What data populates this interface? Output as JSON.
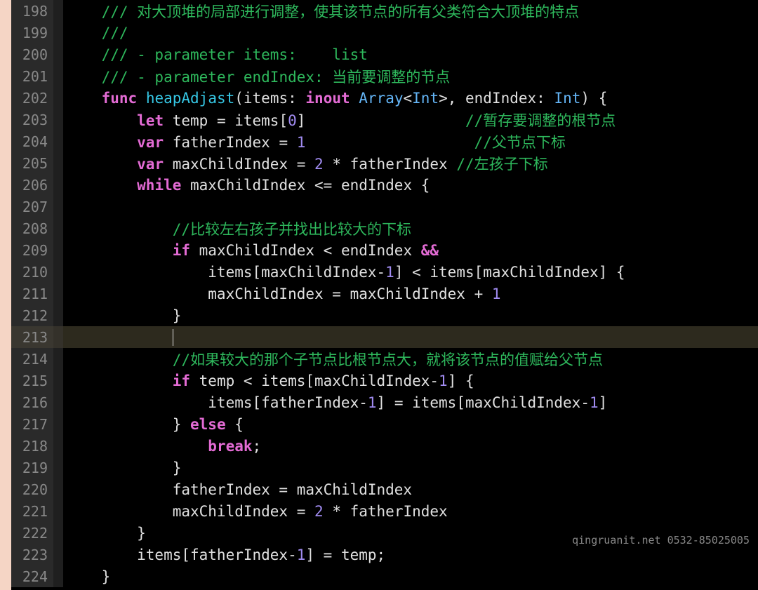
{
  "watermark": "qingruanit.net 0532-85025005",
  "lines": [
    {
      "num": "198",
      "content": [
        {
          "t": "    ",
          "c": ""
        },
        {
          "t": "/// 对大顶堆的局部进行调整，使其该节点的所有父类符合大顶堆的特点",
          "c": "c-comment"
        }
      ]
    },
    {
      "num": "199",
      "content": [
        {
          "t": "    ",
          "c": ""
        },
        {
          "t": "///",
          "c": "c-comment"
        }
      ]
    },
    {
      "num": "200",
      "content": [
        {
          "t": "    ",
          "c": ""
        },
        {
          "t": "/// - parameter items:    list",
          "c": "c-comment"
        }
      ]
    },
    {
      "num": "201",
      "content": [
        {
          "t": "    ",
          "c": ""
        },
        {
          "t": "/// - parameter endIndex: 当前要调整的节点",
          "c": "c-comment"
        }
      ]
    },
    {
      "num": "202",
      "content": [
        {
          "t": "    ",
          "c": ""
        },
        {
          "t": "func",
          "c": "c-keyword"
        },
        {
          "t": " ",
          "c": ""
        },
        {
          "t": "heapAdjast",
          "c": "c-funcname"
        },
        {
          "t": "(items: ",
          "c": "c-op"
        },
        {
          "t": "inout",
          "c": "c-keyword"
        },
        {
          "t": " ",
          "c": ""
        },
        {
          "t": "Array",
          "c": "c-type"
        },
        {
          "t": "<",
          "c": "c-op"
        },
        {
          "t": "Int",
          "c": "c-type"
        },
        {
          "t": ">, endIndex: ",
          "c": "c-op"
        },
        {
          "t": "Int",
          "c": "c-type"
        },
        {
          "t": ") {",
          "c": "c-op"
        }
      ]
    },
    {
      "num": "203",
      "content": [
        {
          "t": "        ",
          "c": ""
        },
        {
          "t": "let",
          "c": "c-keyword"
        },
        {
          "t": " temp = items[",
          "c": "c-op"
        },
        {
          "t": "0",
          "c": "c-number"
        },
        {
          "t": "]                  ",
          "c": "c-op"
        },
        {
          "t": "//暂存要调整的根节点",
          "c": "c-comment"
        }
      ]
    },
    {
      "num": "204",
      "content": [
        {
          "t": "        ",
          "c": ""
        },
        {
          "t": "var",
          "c": "c-keyword"
        },
        {
          "t": " fatherIndex = ",
          "c": "c-op"
        },
        {
          "t": "1",
          "c": "c-number"
        },
        {
          "t": "                   ",
          "c": "c-op"
        },
        {
          "t": "//父节点下标",
          "c": "c-comment"
        }
      ]
    },
    {
      "num": "205",
      "content": [
        {
          "t": "        ",
          "c": ""
        },
        {
          "t": "var",
          "c": "c-keyword"
        },
        {
          "t": " maxChildIndex = ",
          "c": "c-op"
        },
        {
          "t": "2",
          "c": "c-number"
        },
        {
          "t": " * fatherIndex ",
          "c": "c-op"
        },
        {
          "t": "//左孩子下标",
          "c": "c-comment"
        }
      ]
    },
    {
      "num": "206",
      "content": [
        {
          "t": "        ",
          "c": ""
        },
        {
          "t": "while",
          "c": "c-keyword"
        },
        {
          "t": " maxChildIndex <= endIndex {",
          "c": "c-op"
        }
      ]
    },
    {
      "num": "207",
      "content": [
        {
          "t": "",
          "c": ""
        }
      ]
    },
    {
      "num": "208",
      "content": [
        {
          "t": "            ",
          "c": ""
        },
        {
          "t": "//比较左右孩子并找出比较大的下标",
          "c": "c-comment"
        }
      ]
    },
    {
      "num": "209",
      "content": [
        {
          "t": "            ",
          "c": ""
        },
        {
          "t": "if",
          "c": "c-keyword"
        },
        {
          "t": " maxChildIndex < endIndex ",
          "c": "c-op"
        },
        {
          "t": "&&",
          "c": "c-keyword"
        }
      ]
    },
    {
      "num": "210",
      "content": [
        {
          "t": "                items[maxChildIndex-",
          "c": "c-op"
        },
        {
          "t": "1",
          "c": "c-number"
        },
        {
          "t": "] < items[maxChildIndex] {",
          "c": "c-op"
        }
      ]
    },
    {
      "num": "211",
      "content": [
        {
          "t": "                maxChildIndex = maxChildIndex + ",
          "c": "c-op"
        },
        {
          "t": "1",
          "c": "c-number"
        }
      ]
    },
    {
      "num": "212",
      "content": [
        {
          "t": "            }",
          "c": "c-op"
        }
      ]
    },
    {
      "num": "213",
      "current": true,
      "content": [
        {
          "t": "            ",
          "c": ""
        },
        {
          "cursor": true
        }
      ]
    },
    {
      "num": "214",
      "content": [
        {
          "t": "            ",
          "c": ""
        },
        {
          "t": "//如果较大的那个子节点比根节点大，就将该节点的值赋给父节点",
          "c": "c-comment"
        }
      ]
    },
    {
      "num": "215",
      "content": [
        {
          "t": "            ",
          "c": ""
        },
        {
          "t": "if",
          "c": "c-keyword"
        },
        {
          "t": " temp < items[maxChildIndex-",
          "c": "c-op"
        },
        {
          "t": "1",
          "c": "c-number"
        },
        {
          "t": "] {",
          "c": "c-op"
        }
      ]
    },
    {
      "num": "216",
      "content": [
        {
          "t": "                items[fatherIndex-",
          "c": "c-op"
        },
        {
          "t": "1",
          "c": "c-number"
        },
        {
          "t": "] = items[maxChildIndex-",
          "c": "c-op"
        },
        {
          "t": "1",
          "c": "c-number"
        },
        {
          "t": "]",
          "c": "c-op"
        }
      ]
    },
    {
      "num": "217",
      "content": [
        {
          "t": "            } ",
          "c": "c-op"
        },
        {
          "t": "else",
          "c": "c-keyword"
        },
        {
          "t": " {",
          "c": "c-op"
        }
      ]
    },
    {
      "num": "218",
      "content": [
        {
          "t": "                ",
          "c": ""
        },
        {
          "t": "break",
          "c": "c-break"
        },
        {
          "t": ";",
          "c": "c-op"
        }
      ]
    },
    {
      "num": "219",
      "content": [
        {
          "t": "            }",
          "c": "c-op"
        }
      ]
    },
    {
      "num": "220",
      "content": [
        {
          "t": "            fatherIndex = maxChildIndex",
          "c": "c-op"
        }
      ]
    },
    {
      "num": "221",
      "content": [
        {
          "t": "            maxChildIndex = ",
          "c": "c-op"
        },
        {
          "t": "2",
          "c": "c-number"
        },
        {
          "t": " * fatherIndex",
          "c": "c-op"
        }
      ]
    },
    {
      "num": "222",
      "content": [
        {
          "t": "        }",
          "c": "c-op"
        }
      ]
    },
    {
      "num": "223",
      "content": [
        {
          "t": "        items[fatherIndex-",
          "c": "c-op"
        },
        {
          "t": "1",
          "c": "c-number"
        },
        {
          "t": "] = temp;",
          "c": "c-op"
        }
      ]
    },
    {
      "num": "224",
      "content": [
        {
          "t": "    }",
          "c": "c-op"
        }
      ]
    }
  ]
}
